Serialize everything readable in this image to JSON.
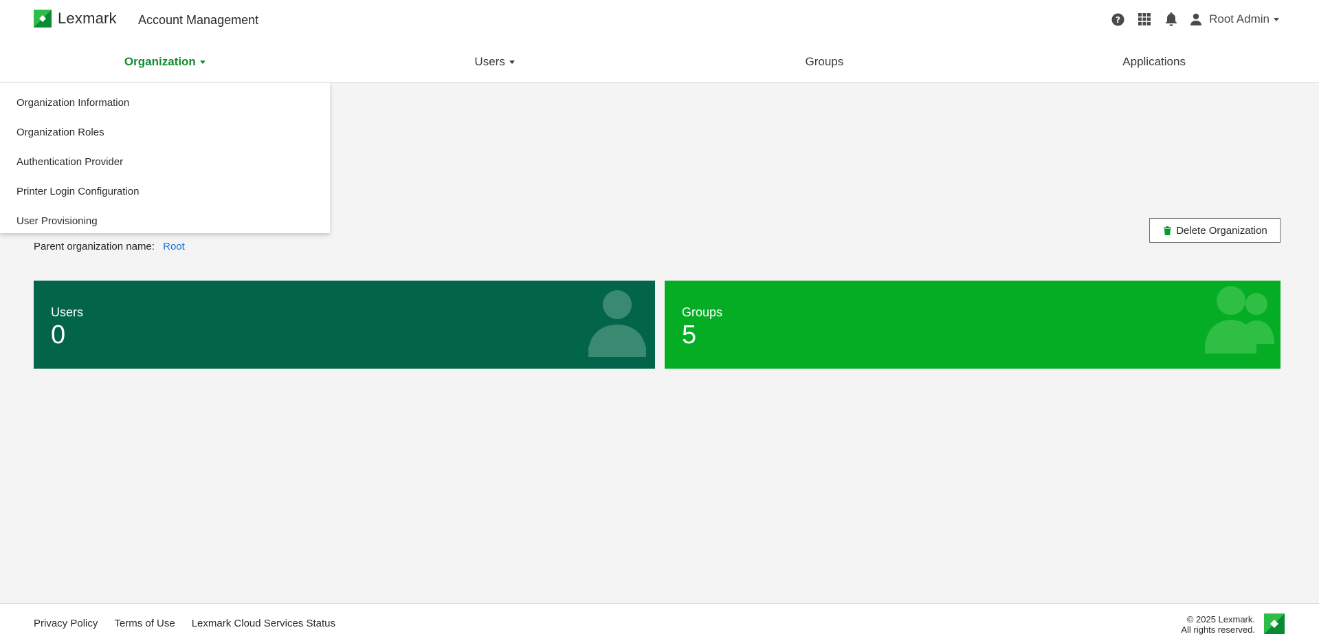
{
  "header": {
    "brand": "Lexmark",
    "app_title": "Account Management",
    "user_name": "Root Admin",
    "icons": [
      "help-icon",
      "apps-grid-icon",
      "bell-icon",
      "user-icon"
    ]
  },
  "nav": {
    "items": [
      {
        "label": "Organization",
        "has_caret": true,
        "active": true
      },
      {
        "label": "Users",
        "has_caret": true,
        "active": false
      },
      {
        "label": "Groups",
        "has_caret": false,
        "active": false
      },
      {
        "label": "Applications",
        "has_caret": false,
        "active": false
      }
    ]
  },
  "org_dropdown": {
    "items": [
      "Organization Information",
      "Organization Roles",
      "Authentication Provider",
      "Printer Login Configuration",
      "User Provisioning"
    ]
  },
  "main": {
    "parent_label": "Parent organization name:",
    "parent_value": "Root",
    "delete_button": "Delete Organization"
  },
  "tiles": {
    "users": {
      "label": "Users",
      "count": "0"
    },
    "groups": {
      "label": "Groups",
      "count": "5"
    }
  },
  "footer": {
    "links": [
      "Privacy Policy",
      "Terms of Use",
      "Lexmark Cloud Services Status"
    ],
    "copyright_line1": "© 2025 Lexmark.",
    "copyright_line2": "All rights reserved."
  },
  "colors": {
    "accent_green": "#138d2e",
    "users_tile": "#02654a",
    "groups_tile": "#04ad23",
    "link_blue": "#1a6fd1"
  }
}
